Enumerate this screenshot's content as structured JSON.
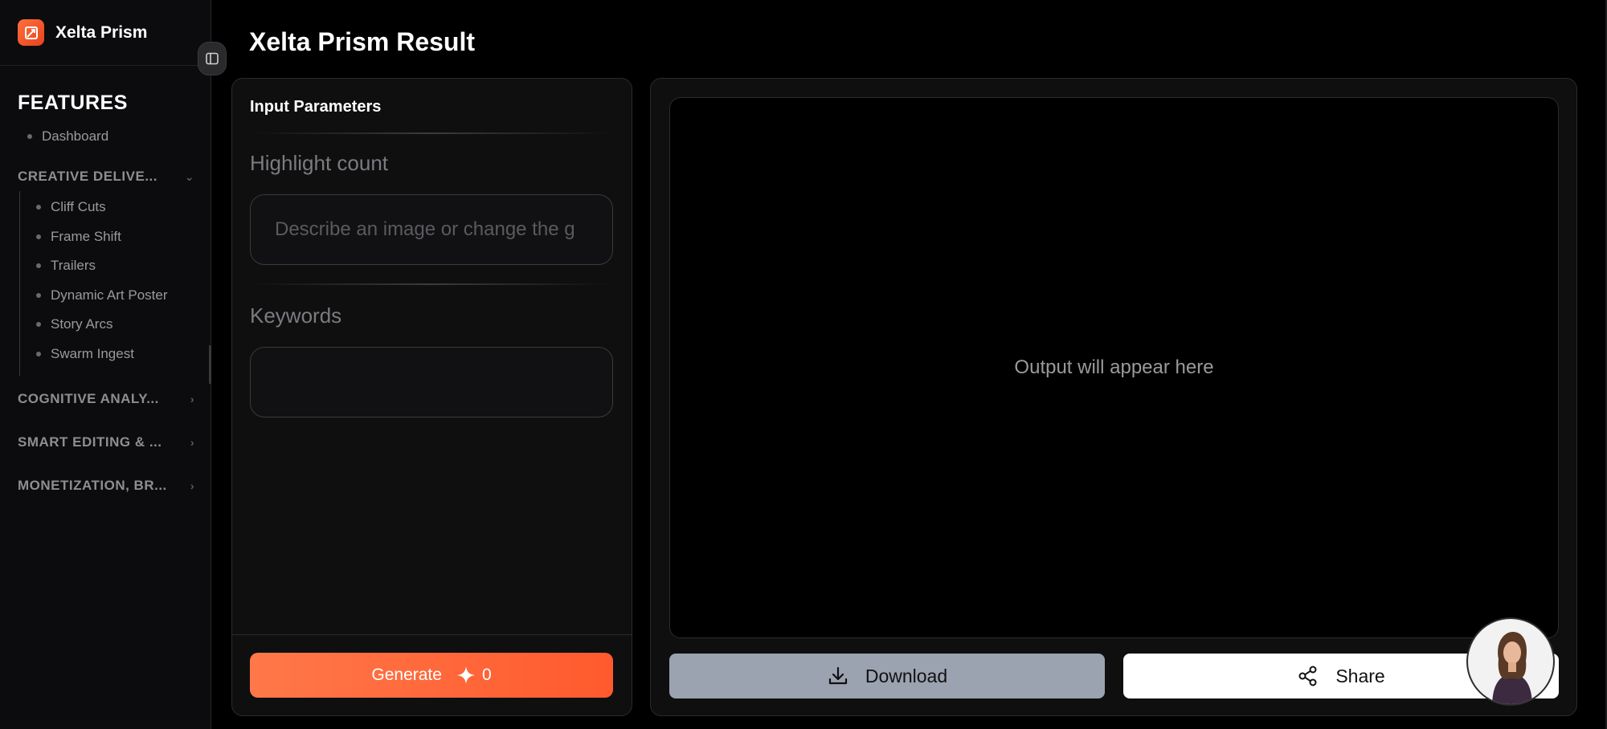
{
  "sidebar": {
    "brand": "Xelta Prism",
    "features_title": "FEATURES",
    "dashboard": "Dashboard",
    "groups": [
      {
        "label": "CREATIVE DELIVE...",
        "chevron": "chevron-down-icon"
      },
      {
        "label": "COGNITIVE ANALY...",
        "chevron": "chevron-right-icon"
      },
      {
        "label": "SMART EDITING & ...",
        "chevron": "chevron-right-icon"
      },
      {
        "label": "MONETIZATION, BR...",
        "chevron": "chevron-right-icon"
      }
    ],
    "creative_items": [
      "Cliff Cuts",
      "Frame Shift",
      "Trailers",
      "Dynamic Art Poster",
      "Story Arcs",
      "Swarm Ingest"
    ]
  },
  "main": {
    "title": "Xelta Prism Result",
    "input_panel": {
      "heading": "Input Parameters",
      "highlight_label": "Highlight count",
      "highlight_placeholder": "Describe an image or change the g",
      "keywords_label": "Keywords",
      "keywords_value": "",
      "generate_label": "Generate",
      "credits": "0"
    },
    "output_panel": {
      "placeholder": "Output will appear here",
      "download_label": "Download",
      "share_label": "Share"
    }
  },
  "colors": {
    "accent": "#ff5a2e",
    "download_bg": "#9ba2b0",
    "share_bg": "#ffffff"
  }
}
